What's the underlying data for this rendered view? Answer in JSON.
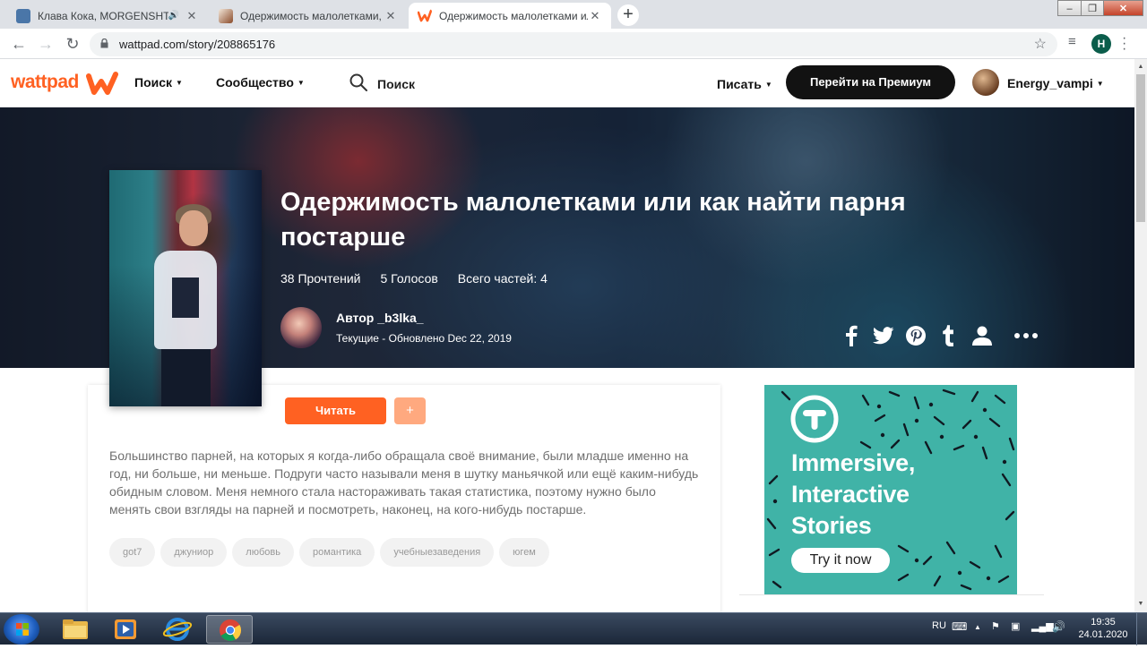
{
  "browser": {
    "tabs": [
      {
        "title": "Клава Кока, MORGENSHTERN",
        "has_audio": true
      },
      {
        "title": "Одержимость малолетками, или",
        "has_audio": false
      },
      {
        "title": "Одержимость малолетками или",
        "has_audio": false
      }
    ],
    "address": "wattpad.com/story/208865176",
    "profile_initial": "H"
  },
  "header": {
    "logo": "wattpad",
    "nav": {
      "search": "Поиск",
      "community": "Сообщество"
    },
    "search_label": "Поиск",
    "write": "Писать",
    "premium": "Перейти на Премиум",
    "username": "Energy_vampi"
  },
  "story": {
    "title": "Одержимость малолетками или как найти парня постарше",
    "reads": "38 Прочтений",
    "votes": "5 Голосов",
    "parts": "Всего частей: 4",
    "author": "Автор _b3lka_",
    "status": "Текущие - Обновлено Dec 22, 2019",
    "read_button": "Читать",
    "add_button": "+",
    "description": "Большинство парней, на которых я когда-либо обращала своё внимание, были младше именно на год, ни больше, ни меньше. Подруги часто называли меня в шутку маньячкой или ещё каким-нибудь обидным словом. Меня немного стала настораживать такая статистика, поэтому нужно было менять свои взгляды на парней и посмотреть, наконец, на кого-нибудь постарше.",
    "tags": [
      "got7",
      "джуниор",
      "любовь",
      "романтика",
      "учебныезаведения",
      "югем"
    ]
  },
  "ad": {
    "line1": "Immersive,",
    "line2": "Interactive",
    "line3": "Stories",
    "button": "Try it now"
  },
  "taskbar": {
    "lang": "RU",
    "time": "19:35",
    "date": "24.01.2020"
  },
  "colors": {
    "brand": "#ff6122",
    "premium_bg": "#121212",
    "ad_bg": "#40b3a7"
  }
}
